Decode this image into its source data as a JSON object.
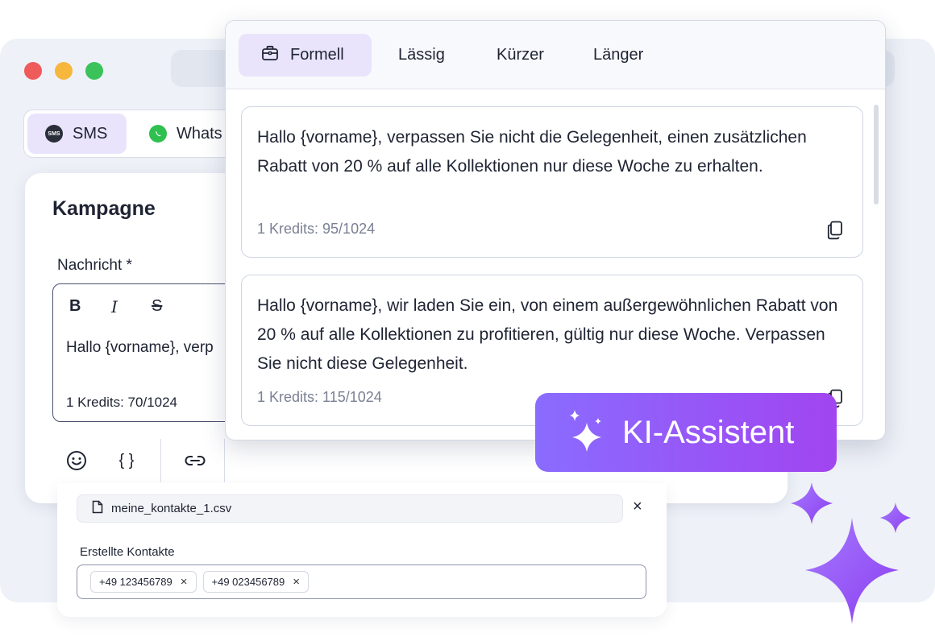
{
  "channels": {
    "sms_label": "SMS",
    "whatsapp_label": "Whats"
  },
  "campaign": {
    "title": "Kampagne",
    "message_label": "Nachricht *",
    "format": {
      "bold": "B",
      "italic": "I",
      "strike": "S"
    },
    "editor_text": "Hallo {vorname}, verp",
    "editor_credits": "1 Kredits: 70/1024",
    "tools": {
      "emoji": "☺",
      "variables": "{ }"
    }
  },
  "contacts": {
    "file_name": "meine_kontakte_1.csv",
    "created_label": "Erstellte Kontakte",
    "chips": [
      "+49 123456789",
      "+49 023456789"
    ]
  },
  "ai_popup": {
    "tones": [
      "Formell",
      "Lässig",
      "Kürzer",
      "Länger"
    ],
    "active_tone": "Formell",
    "suggestions": [
      {
        "text": "Hallo {vorname}, verpassen Sie nicht die Gelegenheit, einen zusätzlichen Rabatt von 20 % auf alle Kollektionen nur diese Woche zu erhalten.",
        "credits": "1 Kredits: 95/1024"
      },
      {
        "text": "Hallo {vorname}, wir laden Sie ein, von einem außergewöhnlichen Rabatt von 20 % auf alle Kollektionen zu profitieren, gültig nur diese Woche. Verpassen Sie nicht diese Gelegenheit.",
        "credits": "1 Kredits: 115/1024"
      }
    ]
  },
  "badge": {
    "label": "KI-Assistent"
  },
  "colors": {
    "accent": "#8a6cff",
    "accent_light": "#e9e4fb",
    "badge_gradient_end": "#a145f0",
    "whatsapp": "#2fc050"
  }
}
